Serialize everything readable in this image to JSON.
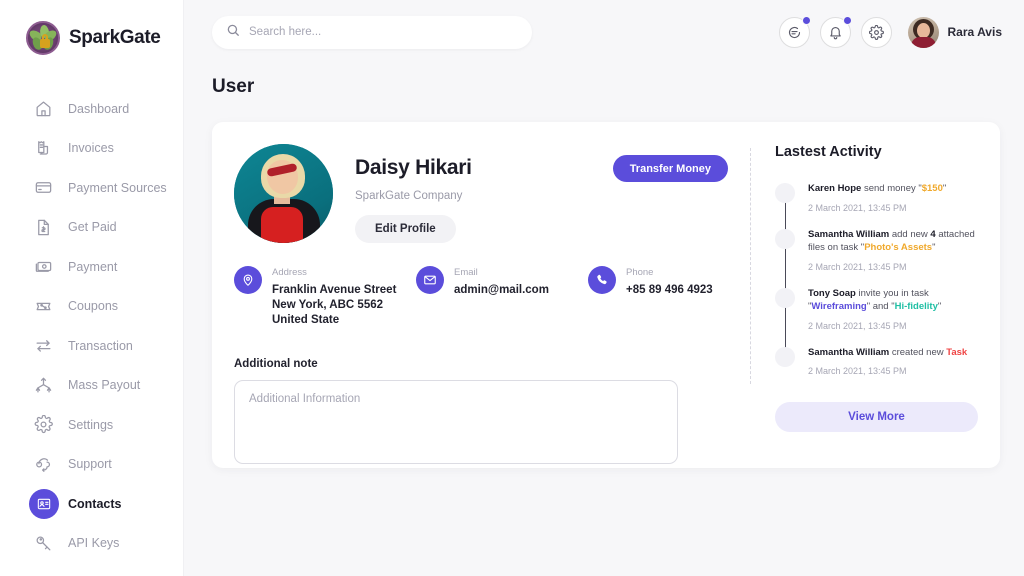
{
  "brand": {
    "name": "SparkGate",
    "logo_icon": "sparkgate-leaf-lock-logo",
    "accent": "#5b4ddb"
  },
  "sidebar": {
    "items": [
      {
        "label": "Dashboard",
        "icon": "home-icon",
        "active": false
      },
      {
        "label": "Invoices",
        "icon": "invoice-icon",
        "active": false
      },
      {
        "label": "Payment Sources",
        "icon": "credit-card-icon",
        "active": false
      },
      {
        "label": "Get Paid",
        "icon": "document-dollar-icon",
        "active": false
      },
      {
        "label": "Payment",
        "icon": "banknote-icon",
        "active": false
      },
      {
        "label": "Coupons",
        "icon": "coupon-percent-icon",
        "active": false
      },
      {
        "label": "Transaction",
        "icon": "transfer-arrows-icon",
        "active": false
      },
      {
        "label": "Mass Payout",
        "icon": "mass-payout-icon",
        "active": false
      },
      {
        "label": "Settings",
        "icon": "gear-icon",
        "active": false
      },
      {
        "label": "Support",
        "icon": "support-headset-icon",
        "active": false
      },
      {
        "label": "Contacts",
        "icon": "contact-card-icon",
        "active": true
      },
      {
        "label": "API  Keys",
        "icon": "key-icon",
        "active": false
      }
    ]
  },
  "topbar": {
    "search": {
      "placeholder": "Search here...",
      "value": "",
      "icon": "search-icon"
    },
    "actions": [
      {
        "name": "messages",
        "icon": "chat-bubble-icon",
        "badge": true
      },
      {
        "name": "notifications",
        "icon": "bell-icon",
        "badge": true
      },
      {
        "name": "settings",
        "icon": "gear-icon",
        "badge": false
      }
    ],
    "user": {
      "name": "Rara Avis",
      "avatar_icon": "user-avatar"
    }
  },
  "page": {
    "title": "User"
  },
  "profile": {
    "avatar_icon": "profile-photo",
    "name": "Daisy Hikari",
    "company": "SparkGate Company",
    "edit_label": "Edit Profile",
    "transfer_label": "Transfer Money",
    "contacts": [
      {
        "label": "Address",
        "value": "Franklin Avenue Street\nNew York, ABC 5562\nUnited State",
        "icon": "location-pin-icon"
      },
      {
        "label": "Email",
        "value": "admin@mail.com",
        "icon": "envelope-icon"
      },
      {
        "label": "Phone",
        "value": "+85 89 496 4923",
        "icon": "phone-icon"
      }
    ],
    "note": {
      "label": "Additional note",
      "placeholder": "Additional Information",
      "value": ""
    }
  },
  "activity": {
    "title": "Lastest Activity",
    "view_more_label": "View More",
    "items": [
      {
        "actor": "Karen Hope",
        "parts": [
          {
            "text": " send money \"",
            "style": "plain"
          },
          {
            "text": "$150",
            "style": "amber"
          },
          {
            "text": "\"",
            "style": "plain"
          }
        ],
        "time": "2 March 2021, 13:45 PM"
      },
      {
        "actor": "Samantha William",
        "parts": [
          {
            "text": " add new ",
            "style": "plain"
          },
          {
            "text": "4",
            "style": "bold"
          },
          {
            "text": " attached files on task \"",
            "style": "plain"
          },
          {
            "text": "Photo's Assets",
            "style": "amber"
          },
          {
            "text": "\"",
            "style": "plain"
          }
        ],
        "time": "2 March 2021, 13:45 PM"
      },
      {
        "actor": "Tony Soap",
        "parts": [
          {
            "text": " invite you in task \"",
            "style": "plain"
          },
          {
            "text": "Wireframing",
            "style": "purple"
          },
          {
            "text": "\" and \"",
            "style": "plain"
          },
          {
            "text": "Hi-fidelity",
            "style": "teal"
          },
          {
            "text": "\"",
            "style": "plain"
          }
        ],
        "time": "2 March 2021, 13:45 PM"
      },
      {
        "actor": "Samantha William",
        "parts": [
          {
            "text": " created new ",
            "style": "plain"
          },
          {
            "text": "Task",
            "style": "red"
          }
        ],
        "time": "2 March 2021, 13:45 PM"
      }
    ]
  }
}
